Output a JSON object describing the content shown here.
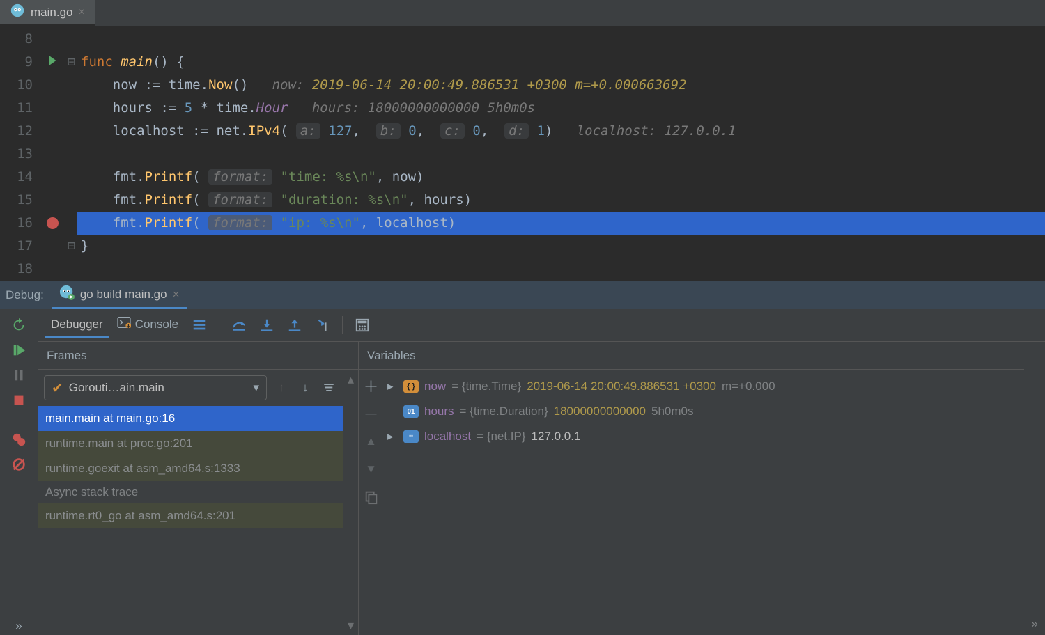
{
  "tab": {
    "filename": "main.go"
  },
  "debugTitle": "Debug:",
  "runConfig": "go build main.go",
  "editor": {
    "startLine": 8,
    "activeLine": 16,
    "breakpointLine": 16,
    "runnableLine": 9,
    "lines": [
      {
        "n": 8,
        "tokens": []
      },
      {
        "n": 9,
        "tokens": [
          [
            "kw",
            "func "
          ],
          [
            "fn",
            "main"
          ],
          [
            "txt",
            "() {"
          ]
        ],
        "fold": "open"
      },
      {
        "n": 10,
        "indent": 1,
        "tokens": [
          [
            "txt",
            "now "
          ],
          [
            "txt",
            ":= "
          ],
          [
            "txt",
            "time."
          ],
          [
            "fn2",
            "Now"
          ],
          [
            "txt",
            "()"
          ]
        ],
        "inlay": {
          "label": "now:",
          "value": "2019-06-14 20:00:49.886531 +0300 m=+0.000663692",
          "cls": "val"
        }
      },
      {
        "n": 11,
        "indent": 1,
        "tokens": [
          [
            "txt",
            "hours "
          ],
          [
            "txt",
            ":= "
          ],
          [
            "num",
            "5"
          ],
          [
            "txt",
            " * "
          ],
          [
            "txt",
            "time."
          ],
          [
            "cst",
            "Hour"
          ]
        ],
        "inlay": {
          "label": "hours:",
          "value": "18000000000000 5h0m0s",
          "cls": "grey"
        }
      },
      {
        "n": 12,
        "indent": 1,
        "tokens": [
          [
            "txt",
            "localhost "
          ],
          [
            "txt",
            ":= "
          ],
          [
            "txt",
            "net."
          ],
          [
            "fn2",
            "IPv4"
          ],
          [
            "txt",
            "( "
          ],
          [
            "param",
            "a:"
          ],
          [
            "txt",
            " "
          ],
          [
            "num",
            "127"
          ],
          [
            "txt",
            ",  "
          ],
          [
            "param",
            "b:"
          ],
          [
            "txt",
            " "
          ],
          [
            "num",
            "0"
          ],
          [
            "txt",
            ",  "
          ],
          [
            "param",
            "c:"
          ],
          [
            "txt",
            " "
          ],
          [
            "num",
            "0"
          ],
          [
            "txt",
            ",  "
          ],
          [
            "param",
            "d:"
          ],
          [
            "txt",
            " "
          ],
          [
            "num",
            "1"
          ],
          [
            "txt",
            ")"
          ]
        ],
        "inlay": {
          "label": "localhost:",
          "value": "127.0.0.1",
          "cls": "grey"
        }
      },
      {
        "n": 13,
        "tokens": []
      },
      {
        "n": 14,
        "indent": 1,
        "tokens": [
          [
            "txt",
            "fmt."
          ],
          [
            "fn2",
            "Printf"
          ],
          [
            "txt",
            "( "
          ],
          [
            "param",
            "format:"
          ],
          [
            "txt",
            " "
          ],
          [
            "str",
            "\"time: %s\\n\""
          ],
          [
            "txt",
            ", now)"
          ]
        ]
      },
      {
        "n": 15,
        "indent": 1,
        "tokens": [
          [
            "txt",
            "fmt."
          ],
          [
            "fn2",
            "Printf"
          ],
          [
            "txt",
            "( "
          ],
          [
            "param",
            "format:"
          ],
          [
            "txt",
            " "
          ],
          [
            "str",
            "\"duration: %s\\n\""
          ],
          [
            "txt",
            ", hours)"
          ]
        ]
      },
      {
        "n": 16,
        "indent": 1,
        "current": true,
        "tokens": [
          [
            "txt",
            "fmt."
          ],
          [
            "fn2",
            "Printf"
          ],
          [
            "txt",
            "( "
          ],
          [
            "paramc",
            "format:"
          ],
          [
            "txt",
            " "
          ],
          [
            "str",
            "\"ip: %s\\n\""
          ],
          [
            "txt",
            ", localhost)"
          ]
        ]
      },
      {
        "n": 17,
        "tokens": [
          [
            "txt",
            "}"
          ]
        ],
        "fold": "close"
      },
      {
        "n": 18,
        "tokens": []
      }
    ]
  },
  "debuggerTabs": {
    "debugger": "Debugger",
    "console": "Console"
  },
  "framesPanel": {
    "title": "Frames",
    "goroutine": "Gorouti…ain.main",
    "frames": [
      {
        "text": "main.main at main.go:16",
        "sel": true
      },
      {
        "text": "runtime.main at proc.go:201",
        "muted": true
      },
      {
        "text": "runtime.goexit at asm_amd64.s:1333",
        "muted": true
      }
    ],
    "asyncLabel": "Async stack trace",
    "asyncFrames": [
      {
        "text": "runtime.rt0_go at asm_amd64.s:201",
        "muted": true
      }
    ]
  },
  "varsPanel": {
    "title": "Variables",
    "rows": [
      {
        "expand": true,
        "badge": "struct",
        "name": "now",
        "type": "{time.Time}",
        "valB": "2019-06-14 20:00:49.886531 +0300 ",
        "valG": "m=+0.000"
      },
      {
        "expand": false,
        "badge": "num",
        "name": "hours",
        "type": "{time.Duration}",
        "valB": "18000000000000 ",
        "valG": "5h0m0s"
      },
      {
        "expand": true,
        "badge": "arr",
        "name": "localhost",
        "type": "{net.IP}",
        "valW": "127.0.0.1"
      }
    ]
  }
}
